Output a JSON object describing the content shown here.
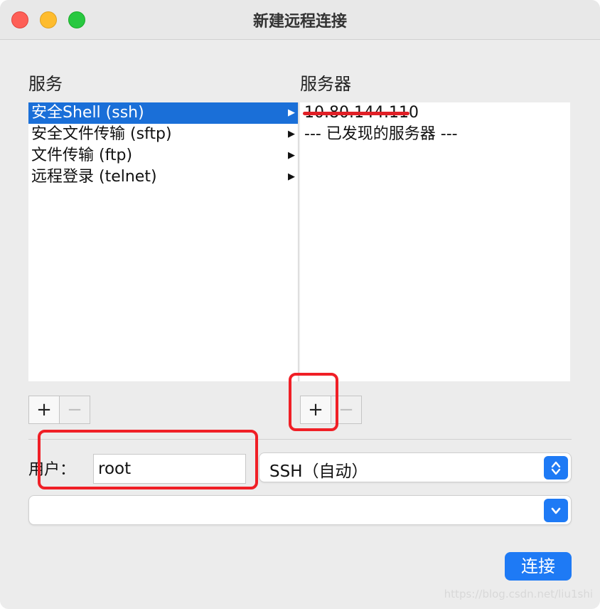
{
  "window": {
    "title": "新建远程连接"
  },
  "services": {
    "label": "服务",
    "items": [
      {
        "label": "安全Shell (ssh)",
        "selected": true
      },
      {
        "label": "安全文件传输 (sftp)",
        "selected": false
      },
      {
        "label": "文件传输 (ftp)",
        "selected": false
      },
      {
        "label": "远程登录 (telnet)",
        "selected": false
      }
    ],
    "add_label": "+",
    "remove_label": "−"
  },
  "servers": {
    "label": "服务器",
    "items": [
      {
        "label": "10.80.144.110",
        "redacted": true
      },
      {
        "label": "--- 已发现的服务器 ---",
        "redacted": false
      }
    ],
    "add_label": "+",
    "remove_label": "−"
  },
  "user": {
    "label": "用户：",
    "value": "root"
  },
  "protocol_select": {
    "value": "SSH（自动）"
  },
  "host_select": {
    "value": ""
  },
  "connect_button": {
    "label": "连接"
  },
  "watermark": "https://blog.csdn.net/liu1shi",
  "colors": {
    "accent": "#1e7af5",
    "selection": "#1a6fd8",
    "annotation": "#f01f26"
  }
}
